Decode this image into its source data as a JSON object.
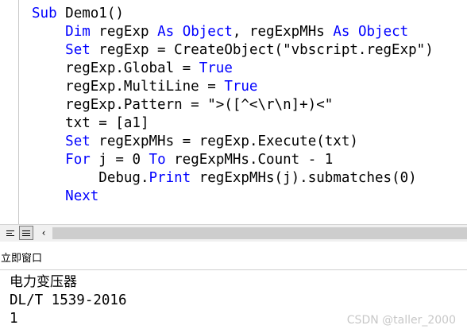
{
  "code_window": {
    "lines": [
      [
        {
          "t": "Sub ",
          "c": "kw"
        },
        {
          "t": "Demo1()",
          "c": "plain"
        }
      ],
      [
        {
          "t": "    ",
          "c": "plain"
        },
        {
          "t": "Dim",
          "c": "kw"
        },
        {
          "t": " regExp ",
          "c": "plain"
        },
        {
          "t": "As",
          "c": "kw"
        },
        {
          "t": " ",
          "c": "plain"
        },
        {
          "t": "Object",
          "c": "kw"
        },
        {
          "t": ", regExpMHs ",
          "c": "plain"
        },
        {
          "t": "As",
          "c": "kw"
        },
        {
          "t": " ",
          "c": "plain"
        },
        {
          "t": "Object",
          "c": "kw"
        }
      ],
      [
        {
          "t": "    ",
          "c": "plain"
        },
        {
          "t": "Set",
          "c": "kw"
        },
        {
          "t": " regExp = CreateObject(\"vbscript.regExp\")",
          "c": "plain"
        }
      ],
      [
        {
          "t": "    regExp.Global = ",
          "c": "plain"
        },
        {
          "t": "True",
          "c": "kw"
        }
      ],
      [
        {
          "t": "    regExp.MultiLine = ",
          "c": "plain"
        },
        {
          "t": "True",
          "c": "kw"
        }
      ],
      [
        {
          "t": "    regExp.Pattern = \">([^<\\r\\n]+)<\"",
          "c": "plain"
        }
      ],
      [
        {
          "t": "    txt = [a1]",
          "c": "plain"
        }
      ],
      [
        {
          "t": "    ",
          "c": "plain"
        },
        {
          "t": "Set",
          "c": "kw"
        },
        {
          "t": " regExpMHs = regExp.Execute(txt)",
          "c": "plain"
        }
      ],
      [
        {
          "t": "    ",
          "c": "plain"
        },
        {
          "t": "For",
          "c": "kw"
        },
        {
          "t": " j = 0 ",
          "c": "plain"
        },
        {
          "t": "To",
          "c": "kw"
        },
        {
          "t": " regExpMHs.Count - 1",
          "c": "plain"
        }
      ],
      [
        {
          "t": "        Debug.",
          "c": "plain"
        },
        {
          "t": "Print",
          "c": "kw"
        },
        {
          "t": " regExpMHs(j).submatches(0)",
          "c": "plain"
        }
      ],
      [
        {
          "t": "    ",
          "c": "plain"
        },
        {
          "t": "Next",
          "c": "kw"
        }
      ]
    ]
  },
  "immediate_window": {
    "title": "立即窗口",
    "output": {
      "line1": "电力变压器",
      "line2": "DL/T 1539-2016",
      "line3": "1"
    }
  },
  "icons": {
    "procedure_view": "procedure-view-icon",
    "full_module_view": "full-module-view-icon",
    "scroll_left": "scroll-left-arrow-icon"
  },
  "colors": {
    "keyword": "#0000ff",
    "text": "#000000"
  },
  "watermark": "CSDN @taller_2000"
}
